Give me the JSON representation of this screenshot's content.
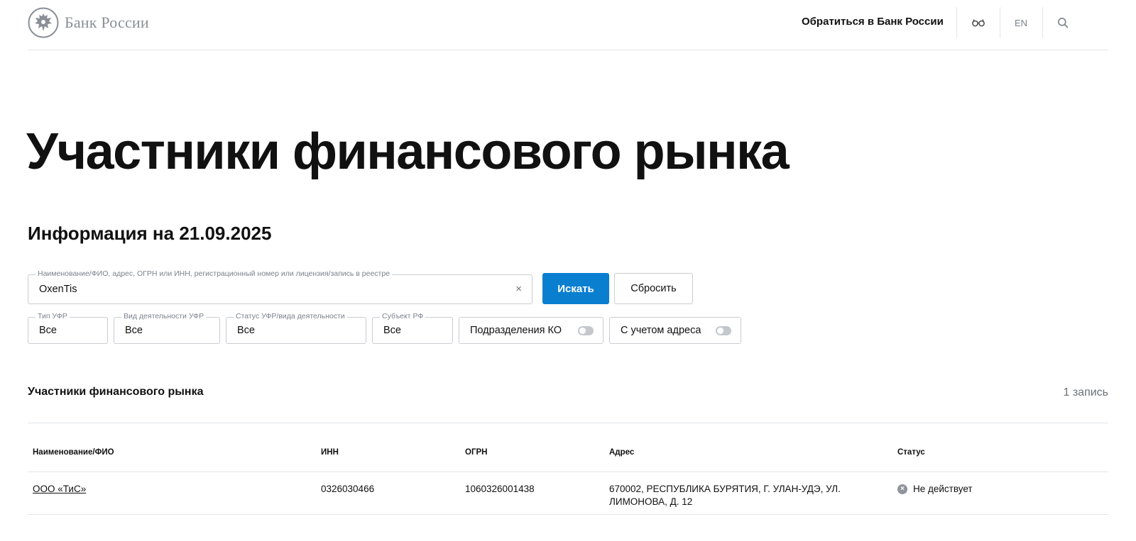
{
  "header": {
    "logo_text": "Банк России",
    "contact_link": "Обратиться в Банк России",
    "language": "EN",
    "icons": [
      "bank-emblem-icon",
      "glasses-icon",
      "search-icon"
    ]
  },
  "page": {
    "title": "Участники финансового рынка",
    "info_date": "Информация на 21.09.2025"
  },
  "search": {
    "label": "Наименование/ФИО, адрес, ОГРН или ИНН, регистрационный номер или лицензия/запись в реестре",
    "value": "OxenTis",
    "clear_symbol": "×",
    "submit_label": "Искать",
    "reset_label": "Сбросить"
  },
  "filters": [
    {
      "label": "Тип УФР",
      "value": "Все"
    },
    {
      "label": "Вид деятельности УФР",
      "value": "Все"
    },
    {
      "label": "Статус УФР/вида деятельности",
      "value": "Все"
    },
    {
      "label": "Субъект РФ",
      "value": "Все"
    }
  ],
  "toggles": [
    {
      "label": "Подразделения КО",
      "on": false
    },
    {
      "label": "С учетом адреса",
      "on": false
    }
  ],
  "results": {
    "title": "Участники финансового рынка",
    "count": "1 запись",
    "columns": [
      "Наименование/ФИО",
      "ИНН",
      "ОГРН",
      "Адрес",
      "Статус"
    ],
    "rows": [
      {
        "name": "ООО «ТиС»",
        "inn": "0326030466",
        "ogrn": "1060326001438",
        "address_line1": "670002, РЕСПУБЛИКА БУРЯТИЯ, Г. УЛАН-УДЭ, УЛ.",
        "address_line2": "ЛИМОНОВА, Д. 12",
        "status": "Не действует",
        "status_symbol": "×"
      }
    ]
  },
  "colors": {
    "primary_button": "#0a7fd0",
    "border": "#c9ccd1",
    "muted_text": "#7b818a"
  }
}
